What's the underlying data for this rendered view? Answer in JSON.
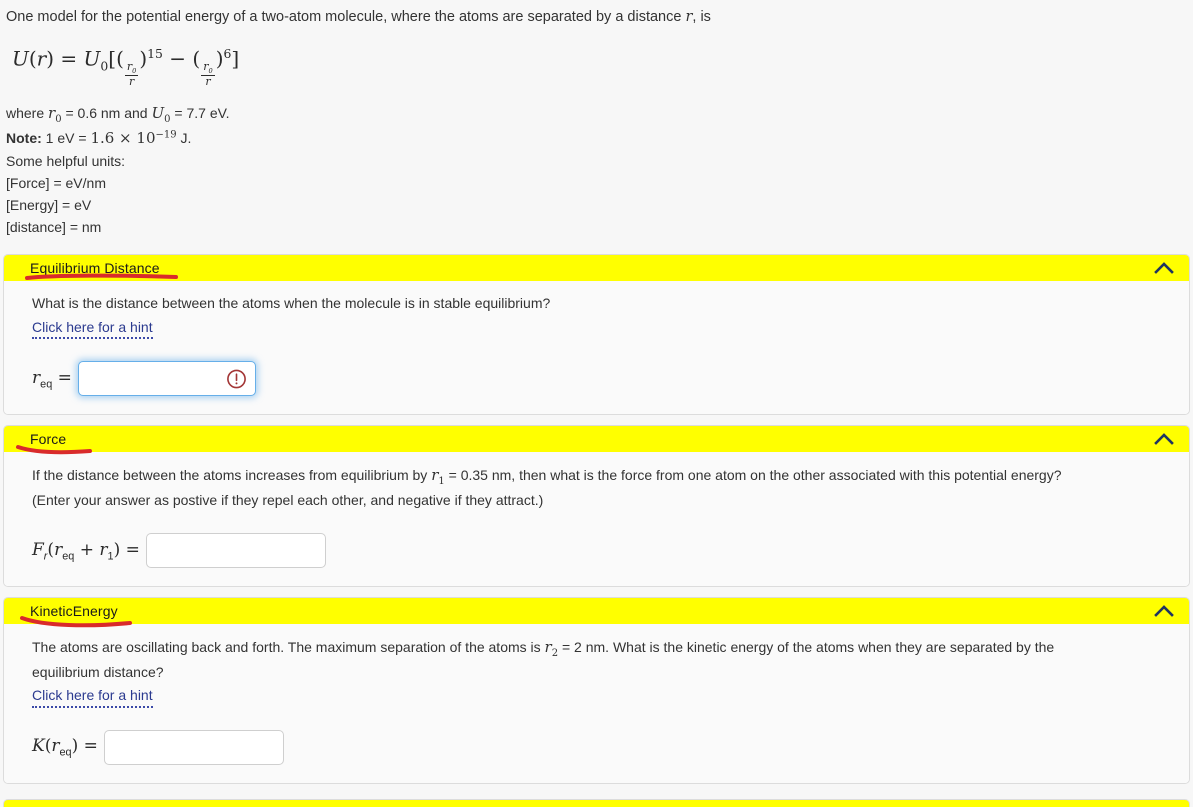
{
  "problem": {
    "intro_before_r": "One model for the potential energy of a two-atom molecule, where the atoms are separated by a distance ",
    "intro_r_symbol": "r",
    "intro_after_r": ", is",
    "equation_plain": "U(r) = U_0[(r_0/r)^15 - (r_0/r)^6]",
    "equation_parts": {
      "lhs_U": "U",
      "lhs_r": "r",
      "rhs_U": "U",
      "rhs_U_sub": "0",
      "numerator": "r",
      "numerator_sub": "0",
      "denominator": "r",
      "exp1": "15",
      "exp2": "6"
    },
    "given_prefix": "where ",
    "given_r0_symbol": "r",
    "given_r0_sub": "0",
    "given_r0_value": " = 0.6 nm and ",
    "given_U0_symbol": "U",
    "given_U0_sub": "0",
    "given_U0_value": " = 7.7 eV.",
    "note_label": "Note:",
    "note_text_1": " 1 eV = ",
    "note_value": "1.6 × 10",
    "note_exp": "−19",
    "note_text_2": " J.",
    "units_heading": "Some helpful units:",
    "units": [
      "[Force] = eV/nm",
      "[Energy] = eV",
      "[distance] = nm"
    ]
  },
  "sections": [
    {
      "id": "equilibrium-distance",
      "title": "Equilibrium Distance",
      "collapse_icon": "chevron-up-icon",
      "question": "What is the distance between the atoms when the molecule is in stable equilibrium?",
      "hint_label": "Click here for a hint",
      "answer": {
        "label_main": "r",
        "label_sub": "eq",
        "label_equals": " =",
        "value": "",
        "placeholder": "",
        "state": "error",
        "error_icon": "exclamation-circle-icon"
      }
    },
    {
      "id": "force",
      "title": "Force",
      "collapse_icon": "chevron-up-icon",
      "question_part1": "If the distance between the atoms increases from equilibrium by ",
      "question_symbol": "r",
      "question_symbol_sub": "1",
      "question_part2": " = 0.35 nm, then what is the force from one atom on the other associated with this potential energy?",
      "question_line2": "(Enter your answer as postive if they repel each other, and negative if they attract.)",
      "answer": {
        "label_F": "F",
        "label_F_sub": "r",
        "label_open": "(",
        "label_r1": "r",
        "label_r1_sub": "eq",
        "label_plus": " + ",
        "label_r2": "r",
        "label_r2_sub": "1",
        "label_close": ") =",
        "value": "",
        "placeholder": "",
        "state": "normal"
      }
    },
    {
      "id": "kinetic-energy",
      "title": "KineticEnergy",
      "collapse_icon": "chevron-up-icon",
      "question_part1": "The atoms are oscillating back and forth. The maximum separation of the atoms is ",
      "question_symbol": "r",
      "question_symbol_sub": "2",
      "question_part2": " = 2 nm. What is the kinetic energy of the atoms when they are separated by the equilibrium distance?",
      "hint_label": "Click here for a hint",
      "answer": {
        "label_K": "K",
        "label_open": "(",
        "label_r": "r",
        "label_r_sub": "eq",
        "label_close": ") =",
        "value": "",
        "placeholder": "",
        "state": "normal"
      }
    }
  ],
  "colors": {
    "header_highlight": "#ffff00",
    "annotation_red": "#d92b2b",
    "hint_link": "#2b3a8f",
    "error_icon": "#a33636",
    "focus_border": "#66afe9",
    "chevron": "#1f3560"
  }
}
